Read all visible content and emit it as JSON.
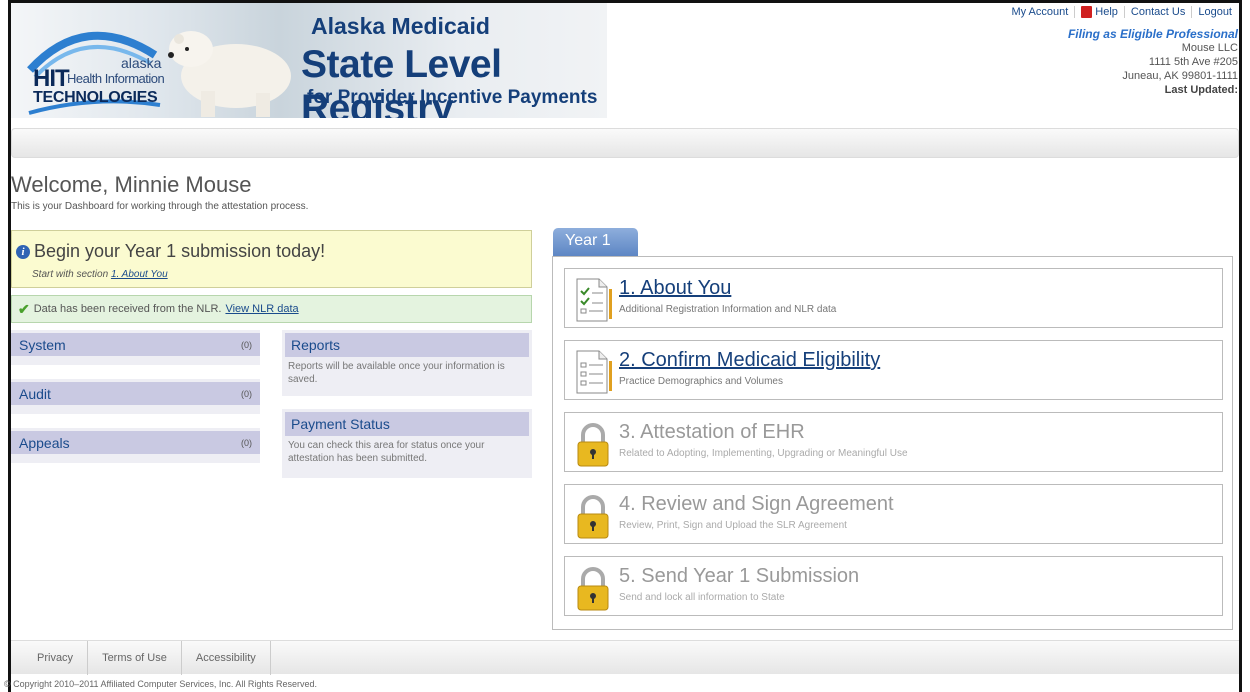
{
  "header": {
    "logo": {
      "hit": "HIT",
      "health_information": "Health Information",
      "alaska": "alaska",
      "technologies": "TECHNOLOGIES"
    },
    "title_line1": "Alaska Medicaid",
    "title_line2": "State Level Registry",
    "title_line3": "for Provider Incentive Payments",
    "topnav": {
      "my_account": "My Account",
      "help": "Help",
      "contact_us": "Contact Us",
      "logout": "Logout"
    },
    "provider": {
      "filing_as": "Filing as Eligible Professional",
      "name": "Mouse LLC",
      "address1": "1111 5th Ave #205",
      "address2": "Juneau, AK 99801-1111",
      "last_updated": "Last Updated:"
    }
  },
  "welcome": {
    "title": "Welcome, Minnie Mouse",
    "subtitle": "This is your Dashboard for working through the attestation process."
  },
  "begin": {
    "title": "Begin your Year 1 submission today!",
    "sub_prefix": "Start with section",
    "sub_link": "1. About You"
  },
  "nlr": {
    "text": "Data has been received from the NLR.",
    "link": "View NLR data"
  },
  "sidebar": [
    {
      "label": "System",
      "count": "(0)"
    },
    {
      "label": "Audit",
      "count": "(0)"
    },
    {
      "label": "Appeals",
      "count": "(0)"
    }
  ],
  "reports": {
    "title": "Reports",
    "text": "Reports will be available once your information is saved."
  },
  "payment": {
    "title": "Payment Status",
    "text": "You can check this area for status once your attestation has been submitted."
  },
  "year_tab": "Year 1",
  "steps": [
    {
      "title": "1. About You",
      "subtitle": "Additional Registration Information and NLR data",
      "state": "active",
      "icon": "checklist-icon"
    },
    {
      "title": "2. Confirm Medicaid Eligibility",
      "subtitle": "Practice Demographics and Volumes",
      "state": "active",
      "icon": "document-icon"
    },
    {
      "title": "3. Attestation of EHR",
      "subtitle": "Related to Adopting, Implementing, Upgrading or Meaningful Use",
      "state": "locked",
      "icon": "padlock-icon"
    },
    {
      "title": "4. Review and Sign Agreement",
      "subtitle": "Review, Print, Sign and Upload the SLR Agreement",
      "state": "locked",
      "icon": "padlock-icon"
    },
    {
      "title": "5. Send Year 1 Submission",
      "subtitle": "Send and lock all information to State",
      "state": "locked",
      "icon": "padlock-icon"
    }
  ],
  "footer": {
    "privacy": "Privacy",
    "terms": "Terms of Use",
    "accessibility": "Accessibility"
  },
  "copyright": "© Copyright 2010–2011 Affiliated Computer Services, Inc. All Rights Reserved."
}
